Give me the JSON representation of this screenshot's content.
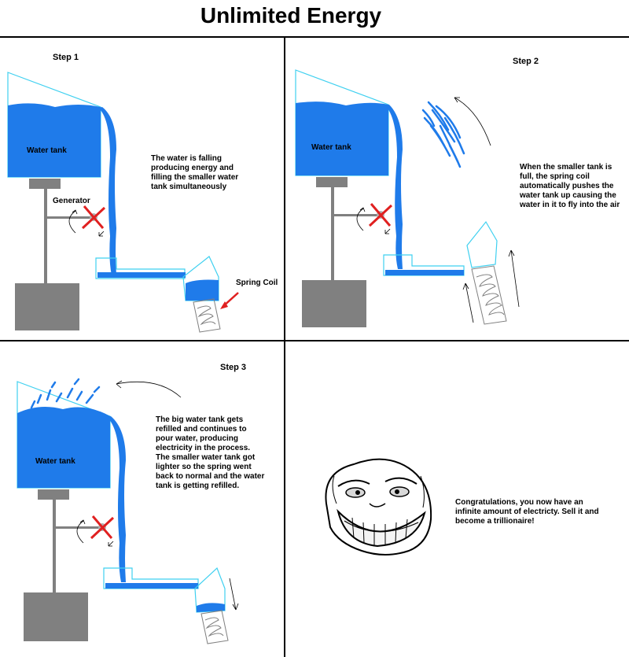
{
  "title": "Unlimited Energy",
  "colors": {
    "water": "#1f7bea",
    "tank_outline": "#3fd0f0",
    "gray": "#808080",
    "arrow_red": "#e02020"
  },
  "panels": {
    "step1": {
      "label": "Step 1",
      "tank_label": "Water tank",
      "generator_label": "Generator",
      "spring_label": "Spring Coil",
      "caption": "The water is falling producing energy and filling the smaller water tank simultaneously"
    },
    "step2": {
      "label": "Step 2",
      "tank_label": "Water tank",
      "caption": "When the smaller tank is full, the spring coil automatically pushes the water tank up causing the water in it to fly into the air"
    },
    "step3": {
      "label": "Step 3",
      "tank_label": "Water tank",
      "caption": "The big water tank gets refilled and continues to pour water, producing electricity in the process. The smaller water tank got lighter so the spring went back to normal and the water tank is getting refilled."
    },
    "final": {
      "face_icon": "troll-face-icon",
      "caption": "Congratulations, you now have an infinite amount of electricty. Sell it and become a trillionaire!"
    }
  }
}
